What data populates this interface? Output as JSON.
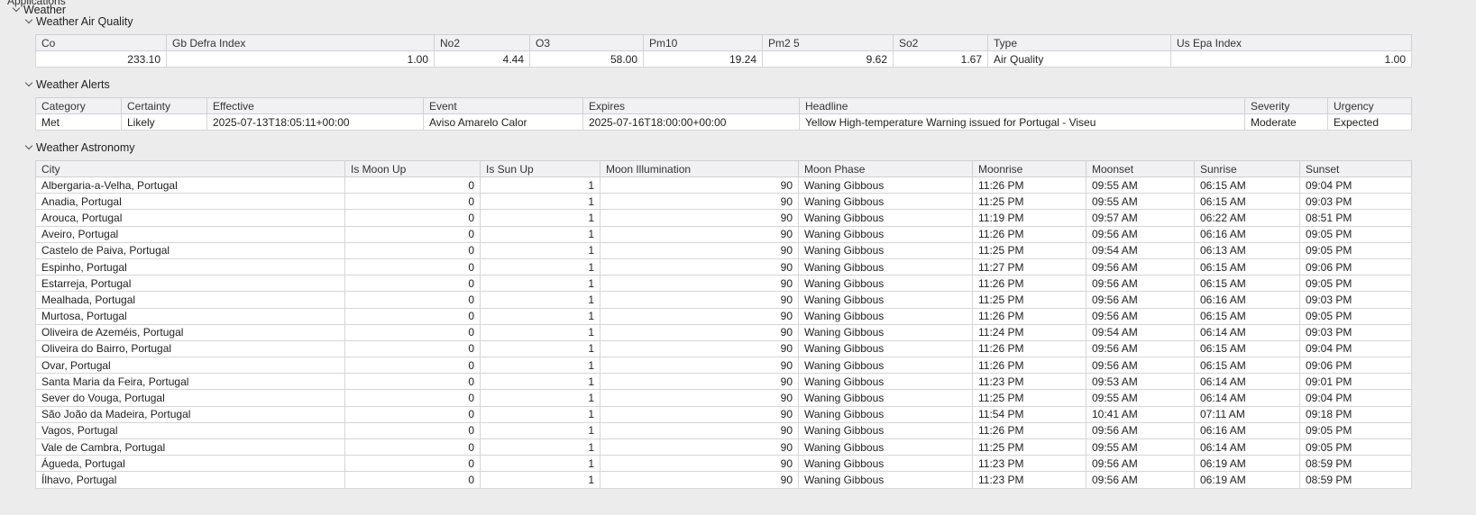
{
  "tree": {
    "root_label": "Applications",
    "weather_label": "Weather",
    "air_quality_label": "Weather Air Quality",
    "alerts_label": "Weather Alerts",
    "astronomy_label": "Weather Astronomy"
  },
  "air_quality": {
    "headers": [
      "Co",
      "Gb Defra Index",
      "No2",
      "O3",
      "Pm10",
      "Pm2 5",
      "So2",
      "Type",
      "Us Epa Index"
    ],
    "row": [
      "233.10",
      "1.00",
      "4.44",
      "58.00",
      "19.24",
      "9.62",
      "1.67",
      "Air Quality",
      "1.00"
    ]
  },
  "alerts": {
    "headers": [
      "Category",
      "Certainty",
      "Effective",
      "Event",
      "Expires",
      "Headline",
      "Severity",
      "Urgency"
    ],
    "row": [
      "Met",
      "Likely",
      "2025-07-13T18:05:11+00:00",
      "Aviso Amarelo Calor",
      "2025-07-16T18:00:00+00:00",
      "Yellow High-temperature Warning issued for Portugal - Viseu",
      "Moderate",
      "Expected"
    ]
  },
  "astronomy": {
    "headers": [
      "City",
      "Is Moon Up",
      "Is Sun Up",
      "Moon Illumination",
      "Moon Phase",
      "Moonrise",
      "Moonset",
      "Sunrise",
      "Sunset"
    ],
    "rows": [
      [
        "Albergaria-a-Velha, Portugal",
        "0",
        "1",
        "90",
        "Waning Gibbous",
        "11:26 PM",
        "09:55 AM",
        "06:15 AM",
        "09:04 PM"
      ],
      [
        "Anadia, Portugal",
        "0",
        "1",
        "90",
        "Waning Gibbous",
        "11:25 PM",
        "09:55 AM",
        "06:15 AM",
        "09:03 PM"
      ],
      [
        "Arouca, Portugal",
        "0",
        "1",
        "90",
        "Waning Gibbous",
        "11:19 PM",
        "09:57 AM",
        "06:22 AM",
        "08:51 PM"
      ],
      [
        "Aveiro, Portugal",
        "0",
        "1",
        "90",
        "Waning Gibbous",
        "11:26 PM",
        "09:56 AM",
        "06:16 AM",
        "09:05 PM"
      ],
      [
        "Castelo de Paiva, Portugal",
        "0",
        "1",
        "90",
        "Waning Gibbous",
        "11:25 PM",
        "09:54 AM",
        "06:13 AM",
        "09:05 PM"
      ],
      [
        "Espinho, Portugal",
        "0",
        "1",
        "90",
        "Waning Gibbous",
        "11:27 PM",
        "09:56 AM",
        "06:15 AM",
        "09:06 PM"
      ],
      [
        "Estarreja, Portugal",
        "0",
        "1",
        "90",
        "Waning Gibbous",
        "11:26 PM",
        "09:56 AM",
        "06:15 AM",
        "09:05 PM"
      ],
      [
        "Mealhada, Portugal",
        "0",
        "1",
        "90",
        "Waning Gibbous",
        "11:25 PM",
        "09:56 AM",
        "06:16 AM",
        "09:03 PM"
      ],
      [
        "Murtosa, Portugal",
        "0",
        "1",
        "90",
        "Waning Gibbous",
        "11:26 PM",
        "09:56 AM",
        "06:15 AM",
        "09:05 PM"
      ],
      [
        "Oliveira de Azeméis, Portugal",
        "0",
        "1",
        "90",
        "Waning Gibbous",
        "11:24 PM",
        "09:54 AM",
        "06:14 AM",
        "09:03 PM"
      ],
      [
        "Oliveira do Bairro, Portugal",
        "0",
        "1",
        "90",
        "Waning Gibbous",
        "11:26 PM",
        "09:56 AM",
        "06:15 AM",
        "09:04 PM"
      ],
      [
        "Ovar, Portugal",
        "0",
        "1",
        "90",
        "Waning Gibbous",
        "11:26 PM",
        "09:56 AM",
        "06:15 AM",
        "09:06 PM"
      ],
      [
        "Santa Maria da Feira, Portugal",
        "0",
        "1",
        "90",
        "Waning Gibbous",
        "11:23 PM",
        "09:53 AM",
        "06:14 AM",
        "09:01 PM"
      ],
      [
        "Sever do Vouga, Portugal",
        "0",
        "1",
        "90",
        "Waning Gibbous",
        "11:25 PM",
        "09:55 AM",
        "06:14 AM",
        "09:04 PM"
      ],
      [
        "São João da Madeira, Portugal",
        "0",
        "1",
        "90",
        "Waning Gibbous",
        "11:54 PM",
        "10:41 AM",
        "07:11 AM",
        "09:18 PM"
      ],
      [
        "Vagos, Portugal",
        "0",
        "1",
        "90",
        "Waning Gibbous",
        "11:26 PM",
        "09:56 AM",
        "06:16 AM",
        "09:05 PM"
      ],
      [
        "Vale de Cambra, Portugal",
        "0",
        "1",
        "90",
        "Waning Gibbous",
        "11:25 PM",
        "09:55 AM",
        "06:14 AM",
        "09:05 PM"
      ],
      [
        "Águeda, Portugal",
        "0",
        "1",
        "90",
        "Waning Gibbous",
        "11:23 PM",
        "09:56 AM",
        "06:19 AM",
        "08:59 PM"
      ],
      [
        "Ílhavo, Portugal",
        "0",
        "1",
        "90",
        "Waning Gibbous",
        "11:23 PM",
        "09:56 AM",
        "06:19 AM",
        "08:59 PM"
      ]
    ]
  }
}
